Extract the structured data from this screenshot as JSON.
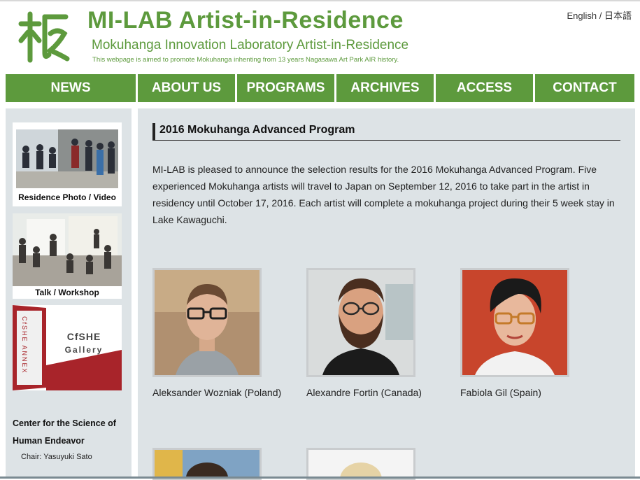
{
  "header": {
    "title": "MI-LAB Artist-in-Residence",
    "subtitle": "Mokuhanga Innovation Laboratory Artist-in-Residence",
    "tagline": "This webpage is aimed to promote Mokuhanga inhenting from 13 years Nagasawa Art Park AIR history.",
    "lang_english": "English",
    "lang_separator": "/",
    "lang_japanese": "日本語"
  },
  "nav": [
    "NEWS",
    "ABOUT US",
    "PROGRAMS",
    "ARCHIVES",
    "ACCESS",
    "CONTACT"
  ],
  "sidebar": {
    "photo_video_label": "Residence Photo / Video",
    "talk_workshop_label": "Talk / Workshop",
    "gallery_sign_line1": "CfSHE",
    "gallery_sign_line2": "Gallery",
    "gallery_wall_text": "CfSHE ANNEX",
    "org_name": "Center for the Science of Human Endeavor",
    "chair": "Chair: Yasuyuki Sato"
  },
  "post": {
    "title": "2016 Mokuhanga Advanced Program",
    "body": "MI-LAB is pleased to announce the selection results for the 2016 Mokuhanga Advanced Program. Five experienced Mokuhanga artists will travel to Japan on September 12, 2016 to take part in the artist in residency until October 17, 2016. Each artist will complete a mokuhanga project during their 5 week stay in Lake Kawaguchi."
  },
  "artists": [
    {
      "name": "Aleksander Wozniak (Poland)"
    },
    {
      "name": "Alexandre Fortin (Canada)"
    },
    {
      "name": "Fabiola Gil (Spain)"
    }
  ],
  "colors": {
    "brand_green": "#5d9a3d",
    "panel_bg": "#dde3e6"
  }
}
